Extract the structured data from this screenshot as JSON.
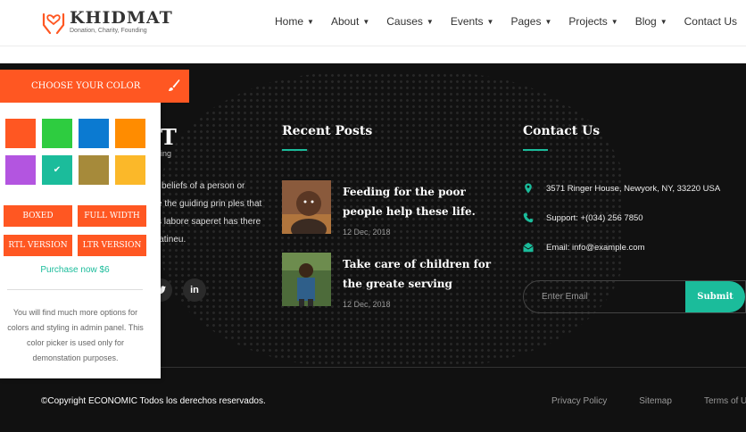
{
  "brand": {
    "title": "KHIDMAT",
    "tagline": "Donation, Charity, Founding"
  },
  "nav": [
    {
      "label": "Home",
      "dropdown": true
    },
    {
      "label": "About",
      "dropdown": true
    },
    {
      "label": "Causes",
      "dropdown": true
    },
    {
      "label": "Events",
      "dropdown": true
    },
    {
      "label": "Pages",
      "dropdown": true
    },
    {
      "label": "Projects",
      "dropdown": true
    },
    {
      "label": "Blog",
      "dropdown": true
    },
    {
      "label": "Contact Us",
      "dropdown": false
    }
  ],
  "about": {
    "title_fragment": "T",
    "subtitle_fragment": "ing",
    "text_lines": [
      "l beliefs of a person or",
      "e the guiding prin ples that",
      "s labore saperet has there",
      "latineu."
    ]
  },
  "recent_posts": {
    "title": "Recent Posts",
    "posts": [
      {
        "title": "Feeding for the poor people help these life.",
        "date": "12 Dec, 2018"
      },
      {
        "title": "Take care of children for the greate serving",
        "date": "12 Dec, 2018"
      }
    ]
  },
  "contact": {
    "title": "Contact Us",
    "address": "3571 Ringer House, Newyork, NY, 33220 USA",
    "support": "Support: +(034) 256 7850",
    "email": "Email: info@example.com",
    "email_placeholder": "Enter Email",
    "submit_label": "Submit"
  },
  "footer_bottom": {
    "copyright": "©Copyright ECONOMIC Todos los derechos reservados.",
    "links": [
      "Privacy Policy",
      "Sitemap",
      "Terms of Use"
    ]
  },
  "color_panel": {
    "title": "CHOOSE YOUR COLOR",
    "swatches": [
      "#ff5722",
      "#2ecc40",
      "#0b7ad1",
      "#ff8c00",
      "#b355e0",
      "#1bbc9b",
      "#a68a3a",
      "#fbb829"
    ],
    "selected_index": 5,
    "buttons": {
      "boxed": "BOXED",
      "full_width": "FULL WIDTH",
      "rtl": "RTL VERSION",
      "ltr": "LTR VERSION"
    },
    "purchase": "Purchase now $6",
    "note": "You will find much more options for colors and styling in admin panel. This color picker is used only for demonstation purposes."
  },
  "colors": {
    "accent": "#ff5722",
    "secondary": "#1bbc9b",
    "footer_bg": "#111111"
  },
  "icons": {
    "address": "map-marker-icon",
    "support": "phone-icon",
    "email": "envelope-icon",
    "panel": "paint-brush-icon"
  }
}
